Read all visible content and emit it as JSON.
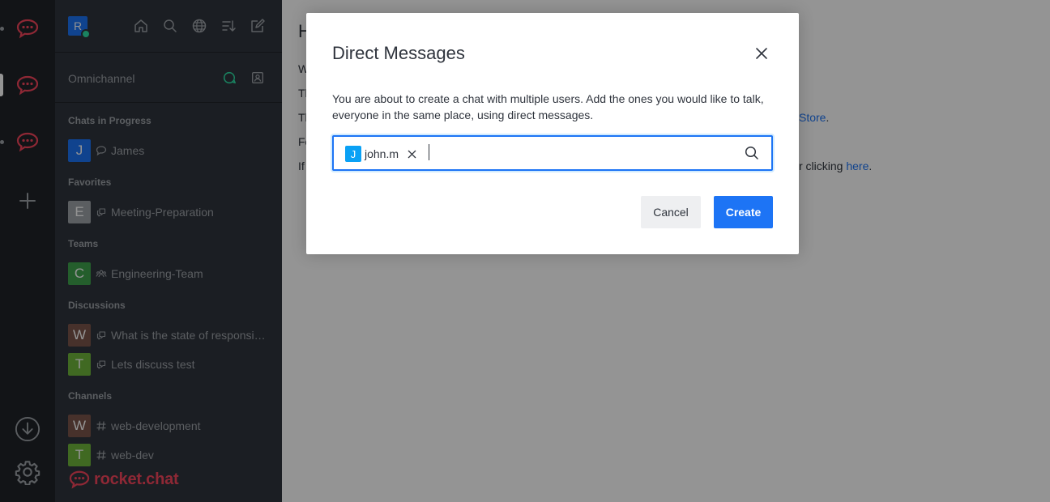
{
  "servers": [
    {
      "name": "rocket-chat-server-1-icon"
    },
    {
      "name": "rocket-chat-server-2-icon"
    },
    {
      "name": "rocket-chat-server-3-icon"
    }
  ],
  "user": {
    "avatar_letter": "R"
  },
  "omnichannel": {
    "label": "Omnichannel"
  },
  "sections": {
    "chats_in_progress": "Chats in Progress",
    "favorites": "Favorites",
    "teams": "Teams",
    "discussions": "Discussions",
    "channels": "Channels"
  },
  "rooms": {
    "james": {
      "letter": "J",
      "name": "James",
      "color": "#1d74f5"
    },
    "meeting": {
      "letter": "E",
      "name": "Meeting-Preparation",
      "color": "#9ea2a8"
    },
    "engineering": {
      "letter": "C",
      "name": "Engineering-Team",
      "color": "#3fa34d"
    },
    "responsive": {
      "letter": "W",
      "name": "What is the state of responsiveness?",
      "color": "#7a554b"
    },
    "test": {
      "letter": "T",
      "name": "Lets discuss test",
      "color": "#6fb53b"
    },
    "webdevelopment": {
      "letter": "W",
      "name": "web-development",
      "color": "#7a554b"
    },
    "webdev": {
      "letter": "T",
      "name": "web-dev",
      "color": "#6fb53b"
    }
  },
  "logo": {
    "text": "rocket.chat"
  },
  "main": {
    "heading": "H",
    "lines": [
      "W",
      "Th",
      "Th",
      "Fo",
      "If"
    ],
    "store_fragment": "Store",
    "clicking_fragment": "r clicking ",
    "here_link": "here",
    "period": "."
  },
  "modal": {
    "title": "Direct Messages",
    "description": "You are about to create a chat with multiple users. Add the ones you would like to talk, everyone in the same place, using direct messages.",
    "selected_user": {
      "letter": "J",
      "name": "john.m"
    },
    "input_value": "",
    "cancel_label": "Cancel",
    "create_label": "Create"
  },
  "colors": {
    "accent": "#1d74f5",
    "brand": "#f5455c",
    "sidebar_bg": "#2f343d",
    "rail_bg": "#1f2329",
    "chip_avatar": "#0aa1f5"
  }
}
